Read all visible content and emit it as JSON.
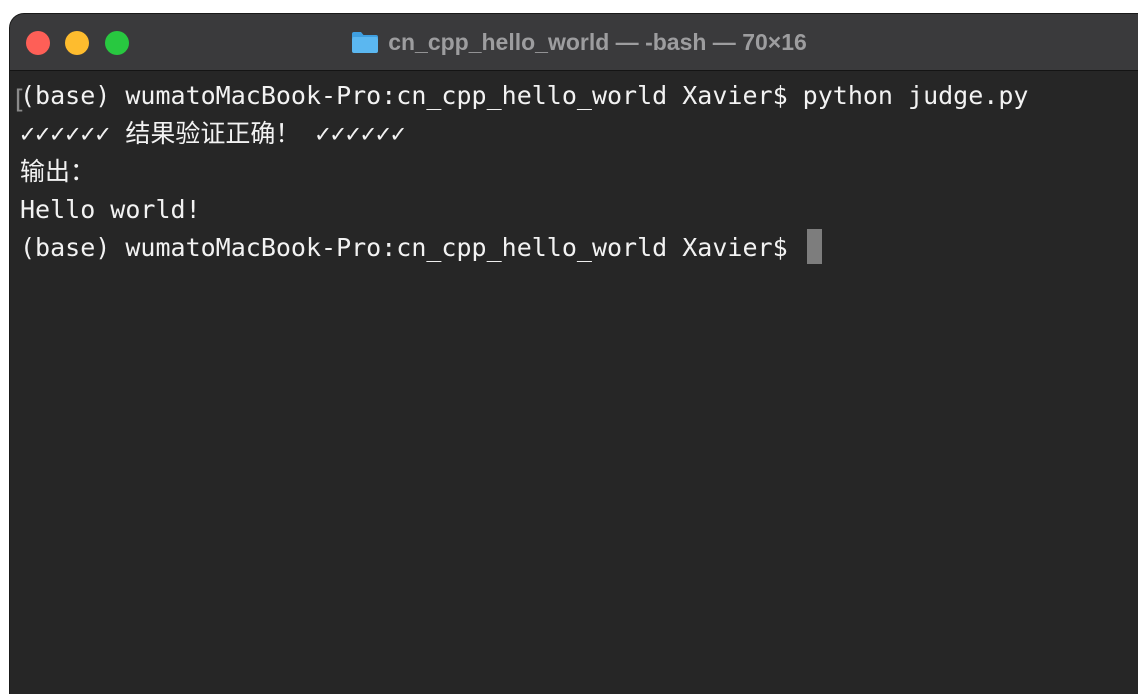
{
  "window": {
    "title": "cn_cpp_hello_world — -bash — 70×16",
    "folder_icon": "folder-icon",
    "colors": {
      "close": "#fe5f57",
      "minimize": "#febc2e",
      "zoom": "#28c840",
      "background": "#262626",
      "text": "#f2f2f2"
    }
  },
  "terminal": {
    "lines": [
      "(base) wumatoMacBook-Pro:cn_cpp_hello_world Xavier$ python judge.py",
      "✓✓✓✓✓✓ 结果验证正确！ ✓✓✓✓✓✓",
      "输出：",
      "Hello world!"
    ],
    "prompt": "(base) wumatoMacBook-Pro:cn_cpp_hello_world Xavier$ "
  }
}
